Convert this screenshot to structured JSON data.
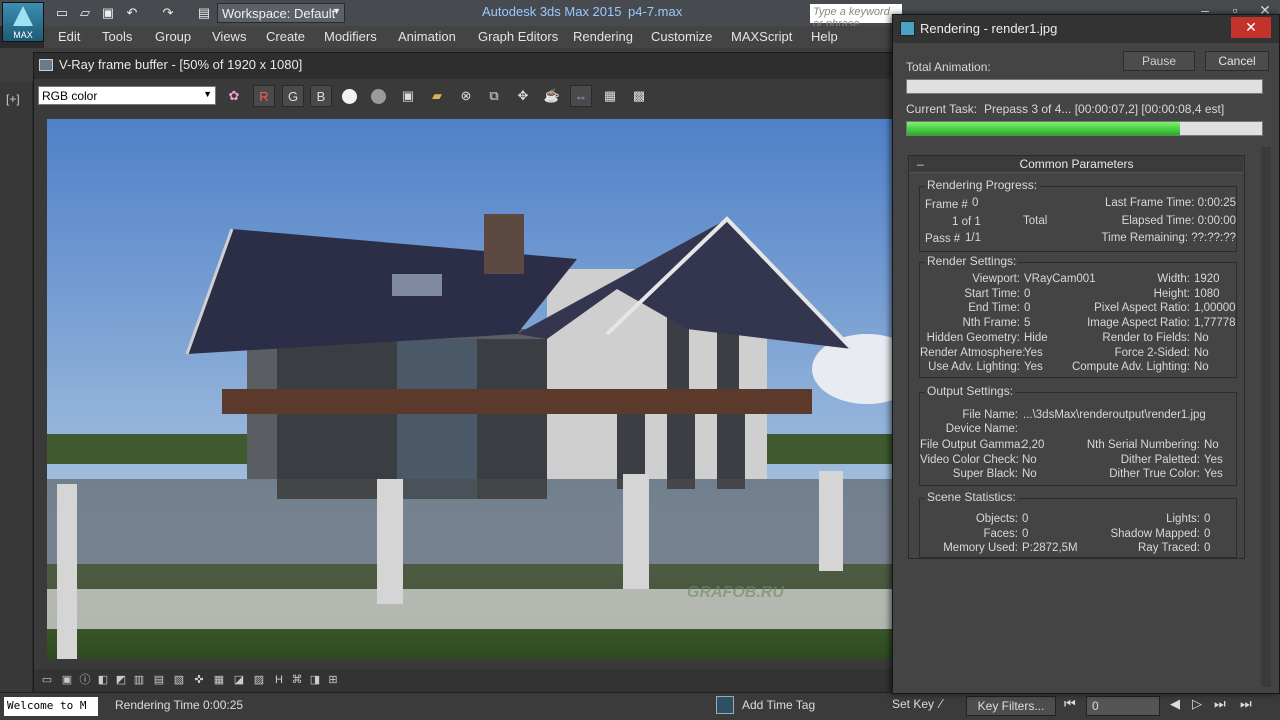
{
  "app": {
    "logo_label": "MAX",
    "workspace": "Workspace: Default",
    "title": "Autodesk 3ds Max 2015",
    "file": "p4-7.max",
    "search_placeholder": "Type a keyword or phrase"
  },
  "menu": [
    "Edit",
    "Tools",
    "Group",
    "Views",
    "Create",
    "Modifiers",
    "Animation",
    "Graph Editors",
    "Rendering",
    "Customize",
    "MAXScript",
    "Help"
  ],
  "viewport": {
    "label": "[+]"
  },
  "vfb": {
    "title": "V-Ray frame buffer - [50% of 1920 x 1080]",
    "channel": "RGB color",
    "r_label": "R",
    "g_label": "G",
    "b_label": "B",
    "watermark": "GRAFOB.RU"
  },
  "status": {
    "listener": "Welcome to M",
    "render_time": "Rendering Time  0:00:25",
    "add_time_tag": "Add Time Tag",
    "set_key": "Set Key",
    "key_filters": "Key Filters...",
    "frame": "0"
  },
  "render_dialog": {
    "title": "Rendering - render1.jpg",
    "total_animation_label": "Total Animation:",
    "pause": "Pause",
    "cancel": "Cancel",
    "total_progress": 0,
    "current_task_label": "Current Task:",
    "current_task": "Prepass 3 of 4... [00:00:07,2] [00:00:08,4 est]",
    "task_progress": 0.77,
    "common_parameters": "Common Parameters",
    "progress_group": {
      "title": "Rendering Progress:",
      "frame_label": "Frame #",
      "frame": "0",
      "of_label": "1 of  1",
      "total": "Total",
      "pass_label": "Pass #",
      "pass": "1/1",
      "last_frame_time": "Last Frame Time:  0:00:25",
      "elapsed_time": "Elapsed Time:  0:00:00",
      "time_remaining": "Time Remaining:  ??:??:??"
    },
    "settings_group": {
      "title": "Render Settings:",
      "left": [
        [
          "Viewport:",
          "VRayCam001"
        ],
        [
          "Start Time:",
          "0"
        ],
        [
          "End Time:",
          "0"
        ],
        [
          "Nth Frame:",
          "5"
        ],
        [
          "Hidden Geometry:",
          "Hide"
        ],
        [
          "Render Atmosphere:",
          "Yes"
        ],
        [
          "Use Adv. Lighting:",
          "Yes"
        ]
      ],
      "right": [
        [
          "Width:",
          "1920"
        ],
        [
          "Height:",
          "1080"
        ],
        [
          "Pixel Aspect Ratio:",
          "1,00000"
        ],
        [
          "Image Aspect Ratio:",
          "1,77778"
        ],
        [
          "Render to Fields:",
          "No"
        ],
        [
          "Force 2-Sided:",
          "No"
        ],
        [
          "Compute Adv. Lighting:",
          "No"
        ]
      ]
    },
    "output_group": {
      "title": "Output Settings:",
      "file_name_label": "File Name:",
      "file_name": "...\\3dsMax\\renderoutput\\render1.jpg",
      "device_name_label": "Device Name:",
      "left": [
        [
          "File Output Gamma:",
          "2,20"
        ],
        [
          "Video Color Check:",
          "No"
        ],
        [
          "Super Black:",
          "No"
        ]
      ],
      "right": [
        [
          "Nth Serial Numbering:",
          "No"
        ],
        [
          "Dither Paletted:",
          "Yes"
        ],
        [
          "Dither True Color:",
          "Yes"
        ]
      ]
    },
    "stats_group": {
      "title": "Scene Statistics:",
      "left": [
        [
          "Objects:",
          "0"
        ],
        [
          "Faces:",
          "0"
        ],
        [
          "Memory Used:",
          "P:2872,5M"
        ]
      ],
      "right": [
        [
          "Lights:",
          "0"
        ],
        [
          "Shadow Mapped:",
          "0"
        ],
        [
          "Ray Traced:",
          "0"
        ]
      ]
    }
  },
  "colors": {
    "progress_green": "#1fb31f",
    "close_red": "#c4322c",
    "title_blue": "#9cc8ff"
  }
}
